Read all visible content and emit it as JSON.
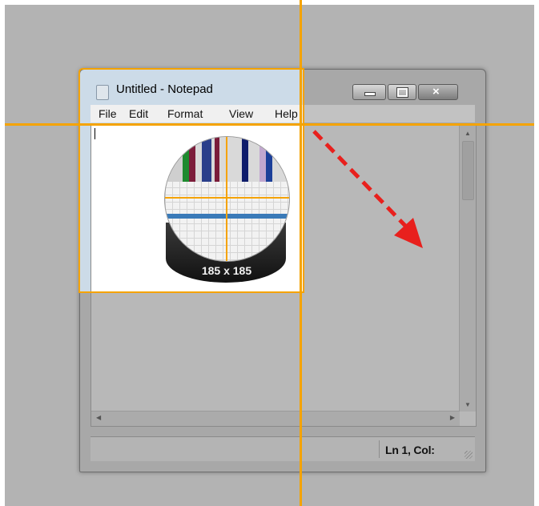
{
  "window": {
    "title": "Untitled - Notepad",
    "controls": {
      "minimize": "minimize",
      "maximize": "maximize",
      "close": "×"
    }
  },
  "menu": {
    "items": [
      "File",
      "Edit",
      "Format",
      "View",
      "Help"
    ]
  },
  "status": {
    "position": "Ln 1, Col:"
  },
  "magnifier": {
    "size_label": "185 x 185"
  },
  "colors": {
    "guide": "#f5a300",
    "arrow": "#e8201d"
  }
}
